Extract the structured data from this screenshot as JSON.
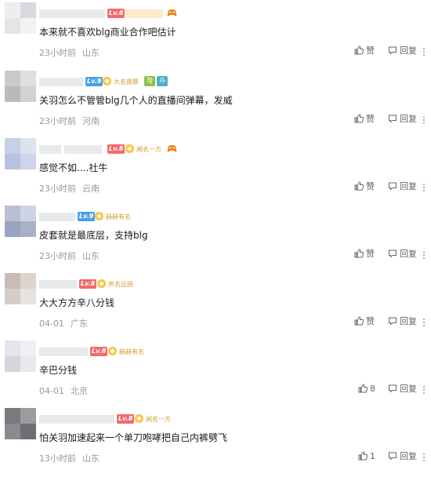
{
  "colors": {
    "lv8": "#f26a6a",
    "lv9": "#4aa0e8",
    "medal": "#f6c24a",
    "meta": "#9499a0"
  },
  "comments": [
    {
      "level": "Lv.8",
      "medal": "",
      "content": "本来就不喜欢blg商业合作吧估计",
      "time": "23小时前",
      "location": "山东",
      "like": "赞",
      "reply": "回复"
    },
    {
      "level": "Lv.9",
      "medal": "大名鼎鼎",
      "content": "关羽怎么不管管blg几个人的直播间弹幕，发威",
      "time": "23小时前",
      "location": "河南",
      "like": "赞",
      "reply": "回复"
    },
    {
      "level": "Lv.8",
      "medal": "闻名一方",
      "content": "感觉不如....社牛",
      "time": "23小时前",
      "location": "云南",
      "like": "赞",
      "reply": "回复"
    },
    {
      "level": "Lv.9",
      "medal": "赫赫有名",
      "content": "皮套就是最底层，支持blg",
      "time": "23小时前",
      "location": "山东",
      "like": "赞",
      "reply": "回复"
    },
    {
      "level": "Lv.8",
      "medal": "声名远扬",
      "content": "大大方方辛八分钱",
      "time": "04-01",
      "location": "广东",
      "like": "赞",
      "reply": "回复"
    },
    {
      "level": "Lv.8",
      "medal": "赫赫有名",
      "content": "辛巴分钱",
      "time": "04-01",
      "location": "北京",
      "like": "8",
      "reply": "回复"
    },
    {
      "level": "Lv.8",
      "medal": "闻名一方",
      "content": "怕关羽加速起来一个单刀咆哮把自己内裤劈飞",
      "time": "13小时前",
      "location": "山东",
      "like": "1",
      "reply": "回复"
    }
  ]
}
